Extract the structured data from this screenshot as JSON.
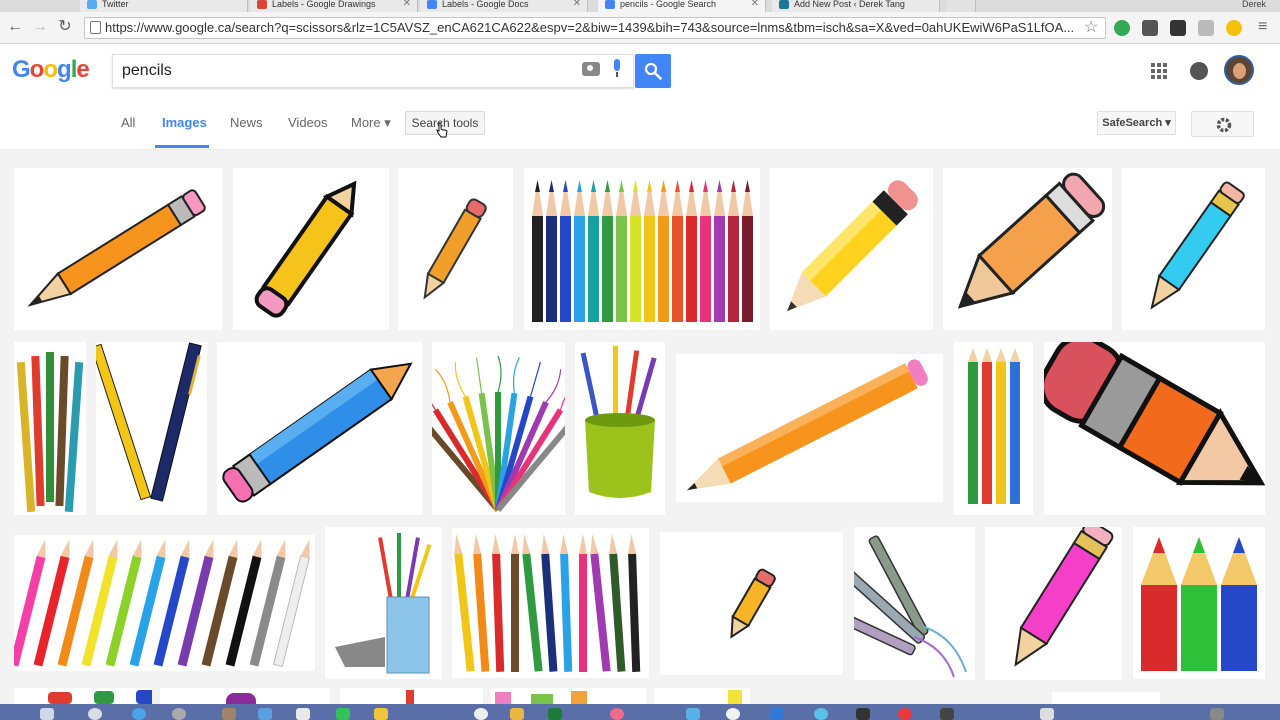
{
  "browser": {
    "tabs": [
      {
        "title": "Twitter",
        "favicon_color": "#55acee"
      },
      {
        "title": "Labels - Google Drawings",
        "favicon_color": "#db4437"
      },
      {
        "title": "Labels - Google Docs",
        "favicon_color": "#4285f4"
      },
      {
        "title": "pencils - Google Search",
        "favicon_color": "#4285f4"
      },
      {
        "title": "Add New Post ‹ Derek Tang",
        "favicon_color": "#21759b"
      }
    ],
    "user_label": "Derek",
    "url": "https://www.google.ca/search?q=scissors&rlz=1C5AVSZ_enCA621CA622&espv=2&biw=1439&bih=743&source=lnms&tbm=isch&sa=X&ved=0ahUKEwiW6PaS1LfOA..."
  },
  "google": {
    "logo_letters": [
      "G",
      "o",
      "o",
      "g",
      "l",
      "e"
    ],
    "logo_colors": [
      "#4285f4",
      "#ea4335",
      "#fbbc05",
      "#4285f4",
      "#34a853",
      "#ea4335"
    ],
    "query": "pencils",
    "search_tabs": [
      "All",
      "Images",
      "News",
      "Videos",
      "More ▾"
    ],
    "active_tab": "Images",
    "search_tools_label": "Search tools",
    "safesearch_label": "SafeSearch ▾",
    "accent": "#4285f4"
  },
  "images": [
    {
      "row": 1,
      "subject": "orange-pencil-diagonal"
    },
    {
      "row": 1,
      "subject": "yellow-pencil-outlined"
    },
    {
      "row": 1,
      "subject": "small-orange-pencil"
    },
    {
      "row": 1,
      "subject": "colored-pencils-row"
    },
    {
      "row": 1,
      "subject": "yellow-pencil-eraser"
    },
    {
      "row": 1,
      "subject": "chunky-orange-pencil"
    },
    {
      "row": 1,
      "subject": "blue-pencil"
    },
    {
      "row": 2,
      "subject": "pencil-bundle"
    },
    {
      "row": 2,
      "subject": "pencil-and-pen"
    },
    {
      "row": 2,
      "subject": "long-blue-pencil"
    },
    {
      "row": 2,
      "subject": "pencil-fan"
    },
    {
      "row": 2,
      "subject": "pencil-cup-green"
    },
    {
      "row": 2,
      "subject": "long-orange-pencil"
    },
    {
      "row": 2,
      "subject": "four-pencils"
    },
    {
      "row": 2,
      "subject": "big-cartoon-pencil"
    },
    {
      "row": 3,
      "subject": "slanted-pencil-row"
    },
    {
      "row": 3,
      "subject": "pencil-cup-blue"
    },
    {
      "row": 3,
      "subject": "pencil-row-colors"
    },
    {
      "row": 3,
      "subject": "tiny-pencil"
    },
    {
      "row": 3,
      "subject": "crayon-markers"
    },
    {
      "row": 3,
      "subject": "pink-pencil"
    },
    {
      "row": 3,
      "subject": "three-stubby-pencils"
    }
  ]
}
